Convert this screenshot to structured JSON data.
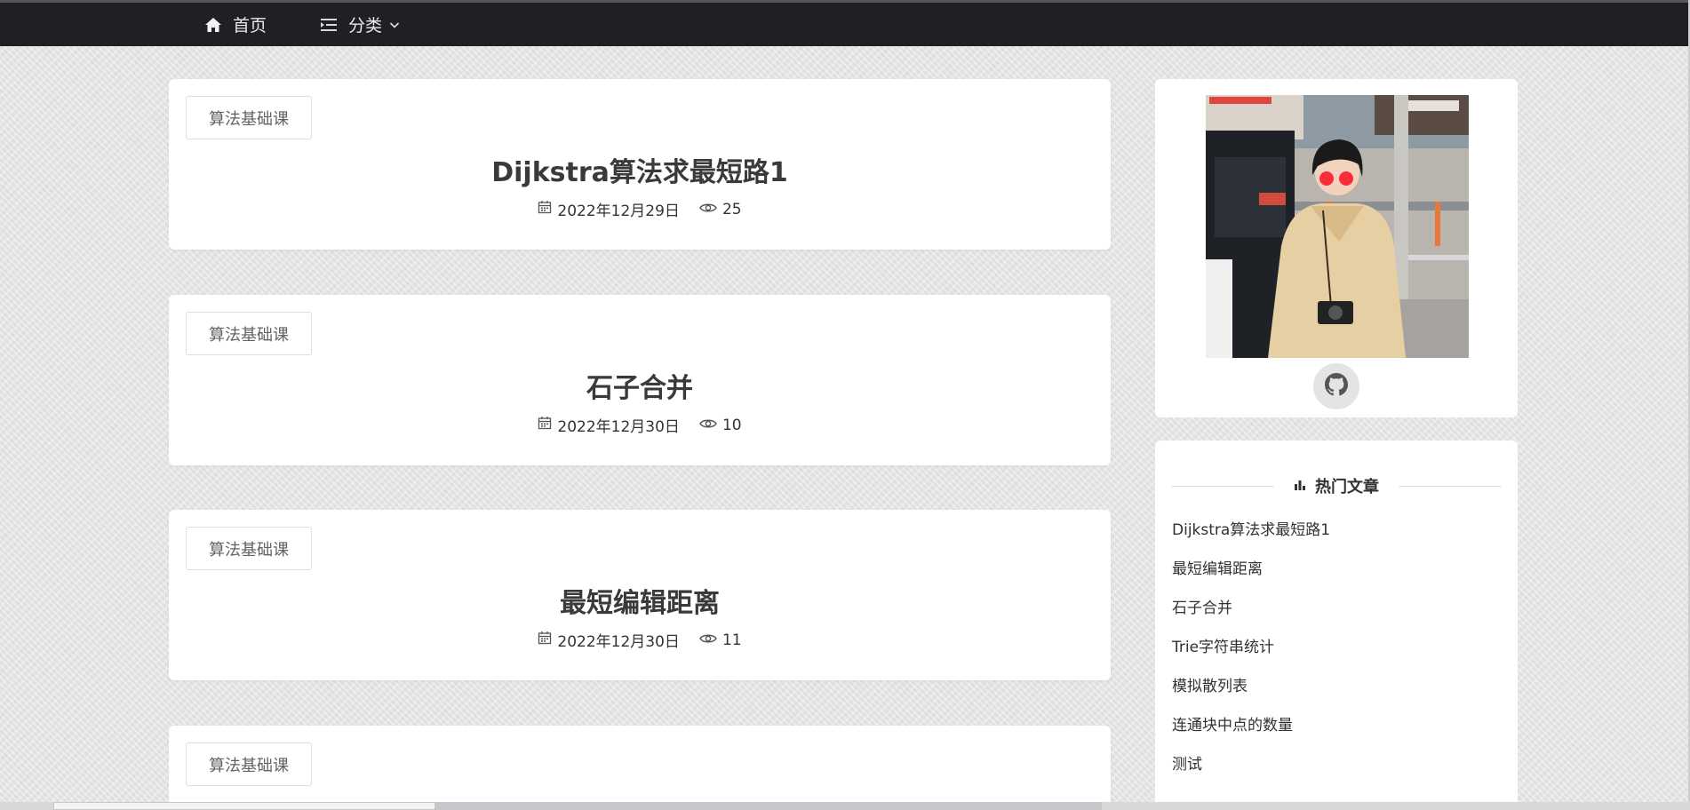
{
  "nav": {
    "home_label": "首页",
    "category_label": "分类"
  },
  "posts": [
    {
      "tag": "算法基础课",
      "title": "Dijkstra算法求最短路1",
      "date": "2022年12月29日",
      "views": "25"
    },
    {
      "tag": "算法基础课",
      "title": "石子合并",
      "date": "2022年12月30日",
      "views": "10"
    },
    {
      "tag": "算法基础课",
      "title": "最短编辑距离",
      "date": "2022年12月30日",
      "views": "11"
    },
    {
      "tag": "算法基础课",
      "title": "",
      "date": "",
      "views": ""
    }
  ],
  "sidebar": {
    "hot_title": "热门文章",
    "hot_items": [
      "Dijkstra算法求最短路1",
      "最短编辑距离",
      "石子合并",
      "Trie字符串统计",
      "模拟散列表",
      "连通块中点的数量",
      "测试"
    ]
  },
  "colors": {
    "nav_bg": "#1f2023",
    "card_bg": "#ffffff",
    "page_bg": "#e8e8e8"
  },
  "icons": {
    "home": "home-icon",
    "category": "menu-fold-icon",
    "date": "calendar-icon",
    "views": "eye-icon",
    "github": "github-icon",
    "hot": "bar-chart-icon"
  }
}
